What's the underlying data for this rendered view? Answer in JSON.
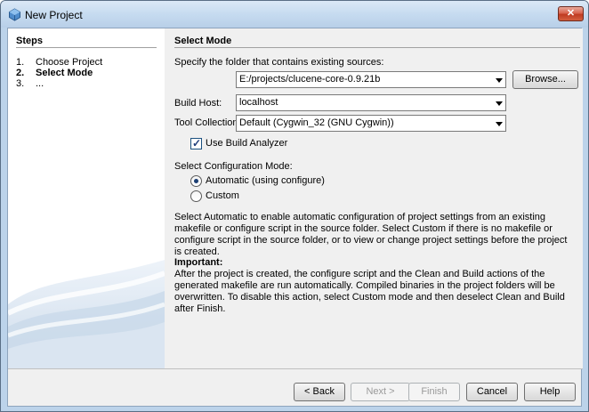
{
  "window": {
    "title": "New Project",
    "close_label": "✕"
  },
  "steps": {
    "title": "Steps",
    "items": [
      {
        "num": "1.",
        "label": "Choose Project"
      },
      {
        "num": "2.",
        "label": "Select Mode"
      },
      {
        "num": "3.",
        "label": "..."
      }
    ]
  },
  "main": {
    "title": "Select Mode",
    "folder_label": "Specify the folder that contains existing sources:",
    "folder_value": "E:/projects/clucene-core-0.9.21b",
    "browse_label": "Browse...",
    "build_host_label": "Build Host:",
    "build_host_value": "localhost",
    "tool_collection_label": "Tool Collection:",
    "tool_collection_value": "Default (Cygwin_32 (GNU Cygwin))",
    "use_build_analyzer_label": "Use Build Analyzer",
    "config_mode_label": "Select Configuration Mode:",
    "automatic_label": "Automatic (using configure)",
    "custom_label": "Custom",
    "description": "Select Automatic to enable automatic configuration of project settings from an existing makefile or configure script in the source folder. Select Custom if there is no makefile or configure script in the source folder, or to view or change project settings before the project is created.",
    "important_heading": "Important:",
    "important_text": "After the project is created, the configure script and the Clean and Build actions of the generated makefile are run automatically. Compiled binaries in the project folders will be overwritten. To disable this action, select Custom mode and then deselect Clean and Build after Finish."
  },
  "buttons": {
    "back": "< Back",
    "next": "Next >",
    "finish": "Finish",
    "cancel": "Cancel",
    "help": "Help"
  }
}
